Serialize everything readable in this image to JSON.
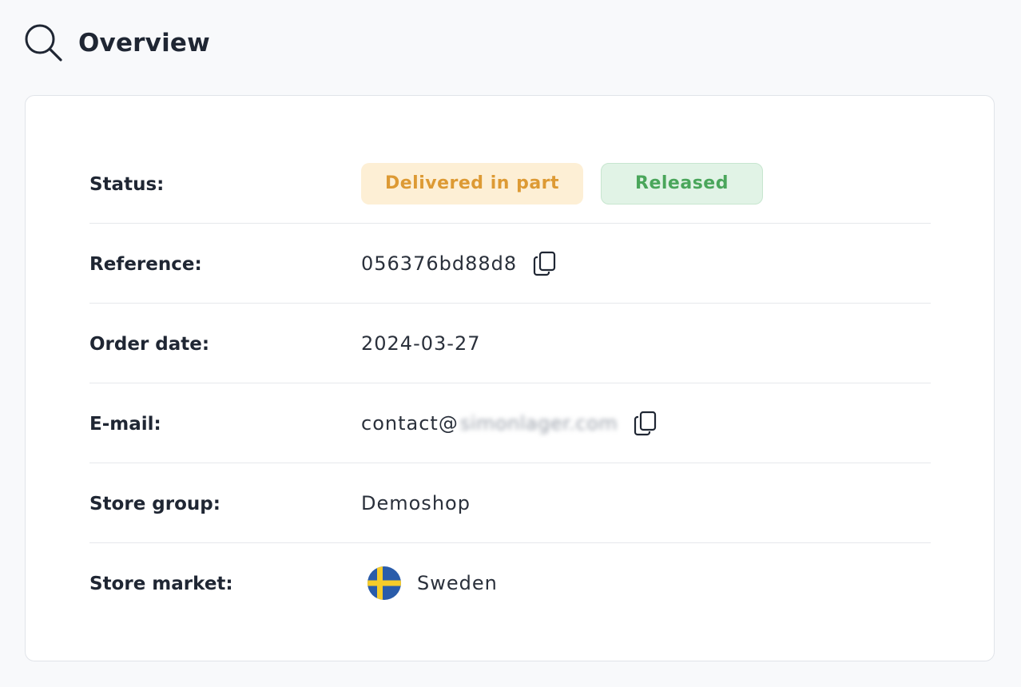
{
  "header": {
    "title": "Overview",
    "icon": "search-icon"
  },
  "overview": {
    "status": {
      "label": "Status:",
      "badges": [
        {
          "text": "Delivered in part",
          "color": "#dd9a34",
          "bg": "#fdefd5"
        },
        {
          "text": "Released",
          "color": "#4aa65b",
          "bg": "#e1f3e6"
        }
      ]
    },
    "reference": {
      "label": "Reference:",
      "value": "056376bd88d8",
      "icon": "copy-icon"
    },
    "order_date": {
      "label": "Order date:",
      "value": "2024-03-27"
    },
    "email": {
      "label": "E-mail:",
      "value_visible": "contact@",
      "value_blurred": "simonlager.com",
      "icon": "copy-icon"
    },
    "store_group": {
      "label": "Store group:",
      "value": "Demoshop"
    },
    "store_market": {
      "label": "Store market:",
      "value": "Sweden",
      "icon": "sweden-flag-icon"
    }
  }
}
